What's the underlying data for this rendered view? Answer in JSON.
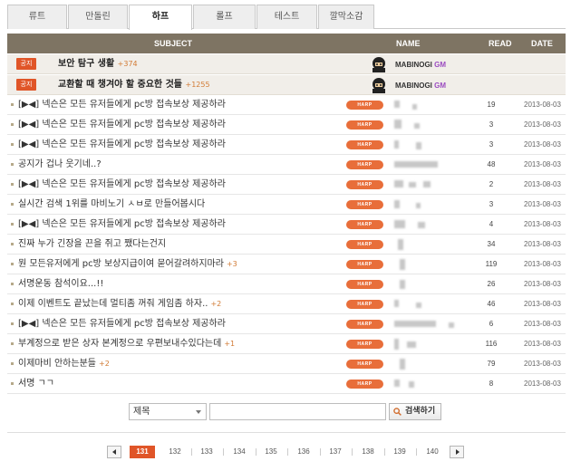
{
  "tabs": [
    "류트",
    "만돌린",
    "하프",
    "롤프",
    "테스트",
    "깔막소감"
  ],
  "active_tab": 2,
  "header": {
    "subject": "SUBJECT",
    "name": "NAME",
    "read": "READ",
    "date": "DATE"
  },
  "notices": [
    {
      "badge": "공지",
      "title": "보안 탐구 생활",
      "count": "+374",
      "author": "MABINOGI",
      "author_tag": "GM"
    },
    {
      "badge": "공지",
      "title": "교환할 때 챙겨야 할 중요한 것들",
      "count": "+1255",
      "author": "MABINOGI",
      "author_tag": "GM"
    }
  ],
  "instrument_badge": "HARP",
  "posts": [
    {
      "title": "[▶◀] 넥슨은 모든 유저들에게 pc방 접속보상 제공하라",
      "comments": "",
      "read": "19",
      "date": "2013-08-03"
    },
    {
      "title": "[▶◀] 넥슨은 모든 유저들에게 pc방 접속보상 제공하라",
      "comments": "",
      "read": "3",
      "date": "2013-08-03"
    },
    {
      "title": "[▶◀] 넥슨은 모든 유저들에게 pc방 접속보상 제공하라",
      "comments": "",
      "read": "3",
      "date": "2013-08-03"
    },
    {
      "title": "공지가 겁나 웃기네..?",
      "comments": "",
      "read": "48",
      "date": "2013-08-03"
    },
    {
      "title": "[▶◀] 넥슨은 모든 유저들에게 pc방 접속보상 제공하라",
      "comments": "",
      "read": "2",
      "date": "2013-08-03"
    },
    {
      "title": "실시간 검색 1위를 마비노기 ㅅㅂ로 만들어봅시다",
      "comments": "",
      "read": "3",
      "date": "2013-08-03"
    },
    {
      "title": "[▶◀] 넥슨은 모든 유저들에게 pc방 접속보상 제공하라",
      "comments": "",
      "read": "4",
      "date": "2013-08-03"
    },
    {
      "title": "진짜 누가 긴장을 끈을 쥐고 쨌다는건지",
      "comments": "",
      "read": "34",
      "date": "2013-08-03"
    },
    {
      "title": "뭔 모든유저에게 pc방 보상지급이여 묻어갈려하지마라",
      "comments": "+3",
      "read": "119",
      "date": "2013-08-03"
    },
    {
      "title": "서명운동 참석이요...!!",
      "comments": "",
      "read": "26",
      "date": "2013-08-03"
    },
    {
      "title": "이제 이벤트도 끝났는데 멀티좀 꺼줘 게임좀 하자..",
      "comments": "+2",
      "read": "46",
      "date": "2013-08-03"
    },
    {
      "title": "[▶◀] 넥슨은 모든 유저들에게 pc방 접속보상 제공하라",
      "comments": "",
      "read": "6",
      "date": "2013-08-03"
    },
    {
      "title": "부계정으로 받은 상자 본계정으로 우편보내수있다는데",
      "comments": "+1",
      "read": "116",
      "date": "2013-08-03"
    },
    {
      "title": "이제마비 안하는분들",
      "comments": "+2",
      "read": "79",
      "date": "2013-08-03"
    },
    {
      "title": "서명 ㄱㄱ",
      "comments": "",
      "read": "8",
      "date": "2013-08-03"
    }
  ],
  "search": {
    "field_label": "제목",
    "query": "",
    "button_label": "검색하기"
  },
  "pagination": {
    "pages": [
      "131",
      "132",
      "133",
      "134",
      "135",
      "136",
      "137",
      "138",
      "139",
      "140"
    ],
    "current": "131"
  },
  "colors": {
    "header_bg": "#7e7463",
    "badge": "#e05528",
    "harp": "#e86e3a",
    "comment": "#d27b35",
    "gm_tag": "#9b4bc0"
  }
}
